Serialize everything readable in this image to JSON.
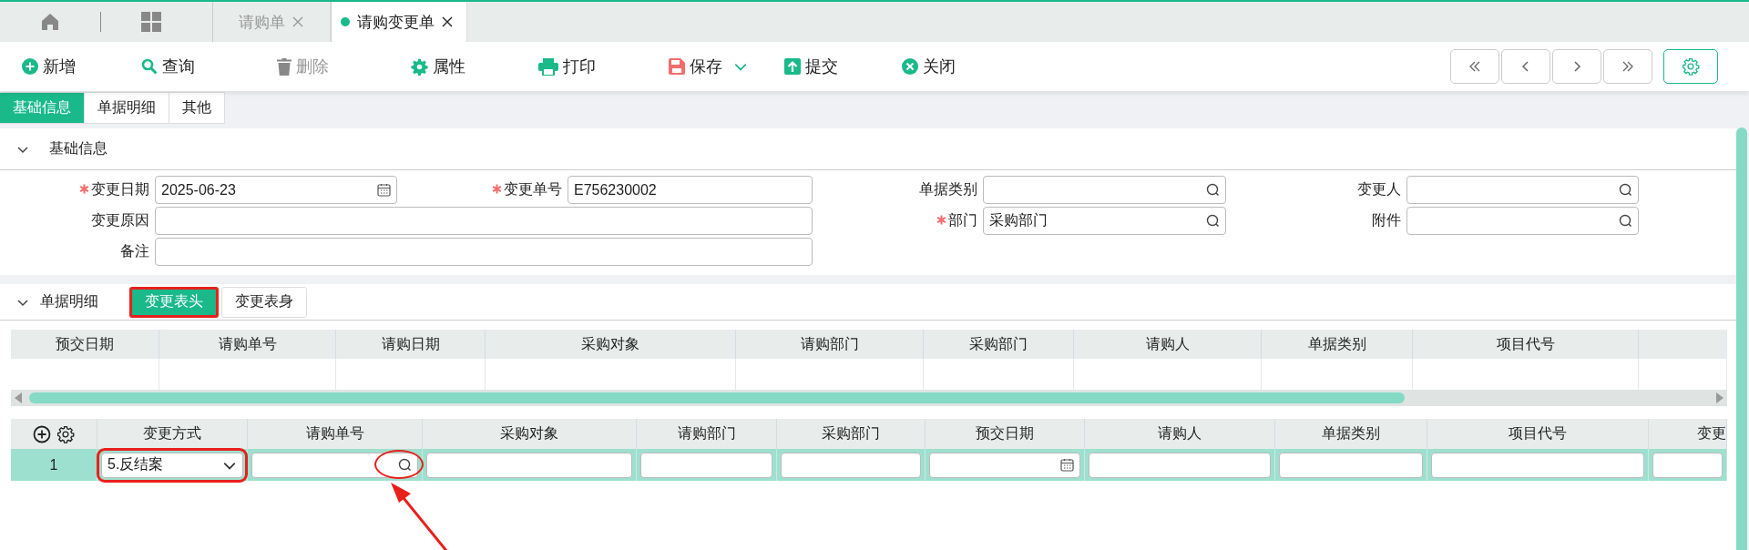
{
  "tabs": [
    {
      "label": "请购单",
      "selected": false
    },
    {
      "label": "请购变更单",
      "selected": true
    }
  ],
  "toolbar": [
    {
      "kind": "add",
      "label": "新增",
      "disabled": false
    },
    {
      "kind": "search",
      "label": "查询",
      "disabled": false
    },
    {
      "kind": "delete",
      "label": "删除",
      "disabled": true
    },
    {
      "kind": "settings",
      "label": "属性",
      "disabled": false
    },
    {
      "kind": "print",
      "label": "打印",
      "disabled": false
    },
    {
      "kind": "save",
      "label": "保存",
      "disabled": false,
      "dropdown": true
    },
    {
      "kind": "submit",
      "label": "提交",
      "disabled": false
    },
    {
      "kind": "close",
      "label": "关闭",
      "disabled": false
    }
  ],
  "sub_tabs": [
    {
      "label": "基础信息",
      "selected": true
    },
    {
      "label": "单据明细",
      "selected": false
    },
    {
      "label": "其他",
      "selected": false
    }
  ],
  "basic_section": {
    "title": "基础信息",
    "expanded": true,
    "fields": [
      {
        "label": "变更日期",
        "required": true,
        "kind": "date",
        "value": "2025-06-23"
      },
      {
        "label": "变更单号",
        "required": true,
        "kind": "text",
        "value": "E756230002"
      },
      {
        "label": "单据类别",
        "required": false,
        "kind": "lookup"
      },
      {
        "label": "变更人",
        "required": false,
        "kind": "lookup"
      },
      {
        "label": "变更原因",
        "required": false,
        "kind": "text",
        "wide": true
      },
      {
        "label": "部门",
        "required": true,
        "kind": "lookup",
        "value": "采购部门"
      },
      {
        "label": "附件",
        "required": false,
        "kind": "lookup"
      },
      {
        "label": "备注",
        "required": false,
        "kind": "text",
        "wide": true
      }
    ]
  },
  "detail_section": {
    "title": "单据明细",
    "expanded": true,
    "tabs": [
      {
        "label": "变更表头",
        "selected": true,
        "highlighted": true
      },
      {
        "label": "变更表身",
        "selected": false,
        "highlighted": false
      }
    ]
  },
  "header_table": {
    "columns": [
      "预交日期",
      "请购单号",
      "请购日期",
      "采购对象",
      "请购部门",
      "采购部门",
      "请购人",
      "单据类别",
      "项目代号"
    ]
  },
  "body_table": {
    "columns": [
      "变更方式",
      "请购单号",
      "采购对象",
      "请购部门",
      "采购部门",
      "预交日期",
      "请购人",
      "单据类别",
      "项目代号",
      "变更"
    ],
    "rows": [
      {
        "number": "1",
        "selected": true,
        "cells": [
          {
            "kind": "select",
            "value": "5.反结案",
            "highlighted": true
          },
          {
            "kind": "lookup",
            "circled": true
          },
          {
            "kind": "text"
          },
          {
            "kind": "text"
          },
          {
            "kind": "text"
          },
          {
            "kind": "date"
          },
          {
            "kind": "text"
          },
          {
            "kind": "text"
          },
          {
            "kind": "text"
          },
          {
            "kind": "text"
          }
        ]
      }
    ]
  }
}
